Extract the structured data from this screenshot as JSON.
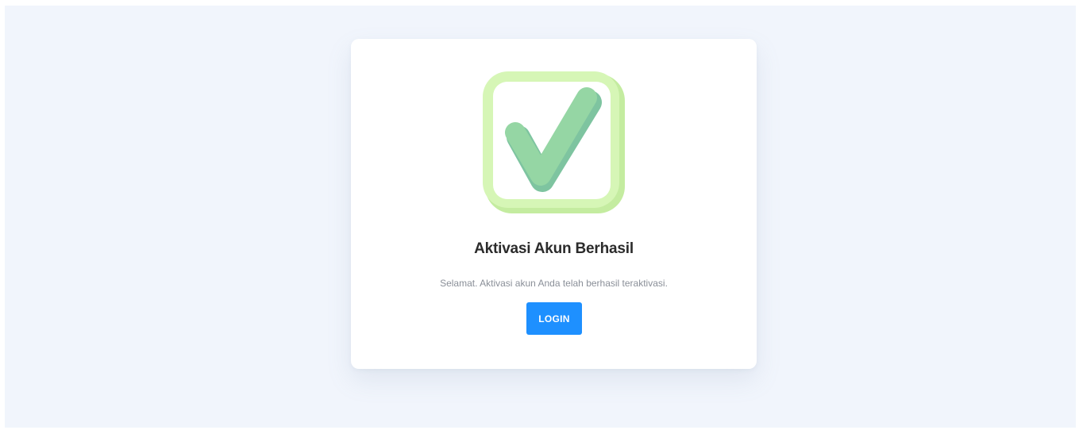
{
  "activation": {
    "title": "Aktivasi Akun Berhasil",
    "message": "Selamat. Aktivasi akun Anda telah berhasil teraktivasi.",
    "login_label": "LOGIN",
    "icon": "checkmark-box-icon"
  },
  "colors": {
    "background": "#f1f5fc",
    "card": "#ffffff",
    "button": "#1e90ff",
    "icon_frame": "#d4f5b0",
    "icon_check": "#95d6a4",
    "icon_check_shadow": "#7ec4a0"
  }
}
